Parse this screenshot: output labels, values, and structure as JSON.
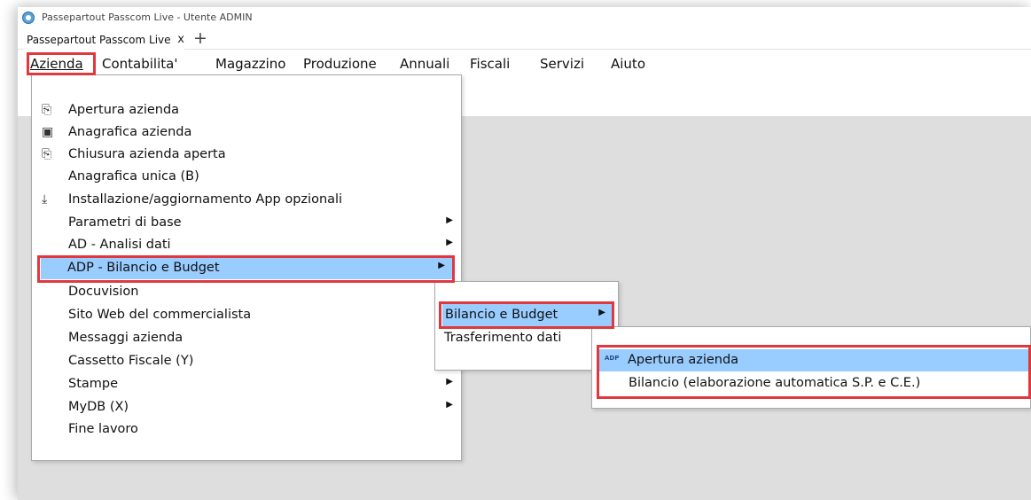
{
  "window": {
    "title": "Passepartout Passcom Live - Utente ADMIN",
    "tab_label": "Passepartout Passcom Live",
    "tab_close": "x",
    "tab_add": "+"
  },
  "menubar": [
    {
      "label": "Azienda"
    },
    {
      "label": "Contabilita'"
    },
    {
      "label": "Magazzino"
    },
    {
      "label": "Produzione"
    },
    {
      "label": "Annuali"
    },
    {
      "label": "Fiscali"
    },
    {
      "label": "Servizi"
    },
    {
      "label": "Aiuto"
    }
  ],
  "azienda_menu": [
    {
      "label": "Apertura azienda",
      "icon": "open-company-icon",
      "submenu": false
    },
    {
      "label": "Anagrafica azienda",
      "icon": "company-registry-icon",
      "submenu": false
    },
    {
      "label": "Chiusura azienda aperta",
      "icon": "close-company-icon",
      "submenu": false
    },
    {
      "label": "Anagrafica unica (B)",
      "icon": "",
      "submenu": false
    },
    {
      "label": "Installazione/aggiornamento App opzionali",
      "icon": "download-icon",
      "submenu": false
    },
    {
      "label": "Parametri di base",
      "icon": "",
      "submenu": true
    },
    {
      "label": "AD - Analisi dati",
      "icon": "",
      "submenu": true
    },
    {
      "label": "ADP - Bilancio e Budget",
      "icon": "",
      "submenu": true,
      "selected": true
    },
    {
      "label": "Docuvision",
      "icon": "",
      "submenu": false
    },
    {
      "label": "Sito Web del commercialista",
      "icon": "",
      "submenu": false
    },
    {
      "label": "Messaggi azienda",
      "icon": "",
      "submenu": false
    },
    {
      "label": "Cassetto Fiscale (Y)",
      "icon": "",
      "submenu": false
    },
    {
      "label": "Stampe",
      "icon": "",
      "submenu": true
    },
    {
      "label": "MyDB (X)",
      "icon": "",
      "submenu": true
    },
    {
      "label": "Fine lavoro",
      "icon": "",
      "submenu": false
    }
  ],
  "adp_submenu": [
    {
      "label": "Bilancio e Budget",
      "submenu": true,
      "selected": true
    },
    {
      "label": "Trasferimento dati",
      "submenu": false
    }
  ],
  "bilancio_submenu": [
    {
      "label": "Apertura azienda",
      "icon": "adp-icon",
      "icon_text": "ADP",
      "selected": true
    },
    {
      "label": "Bilancio (elaborazione automatica S.P. e C.E.)",
      "icon": "",
      "selected": false
    }
  ],
  "colors": {
    "selection": "#99ccff",
    "highlight_border": "#e0383e",
    "workspace": "#dedede"
  }
}
